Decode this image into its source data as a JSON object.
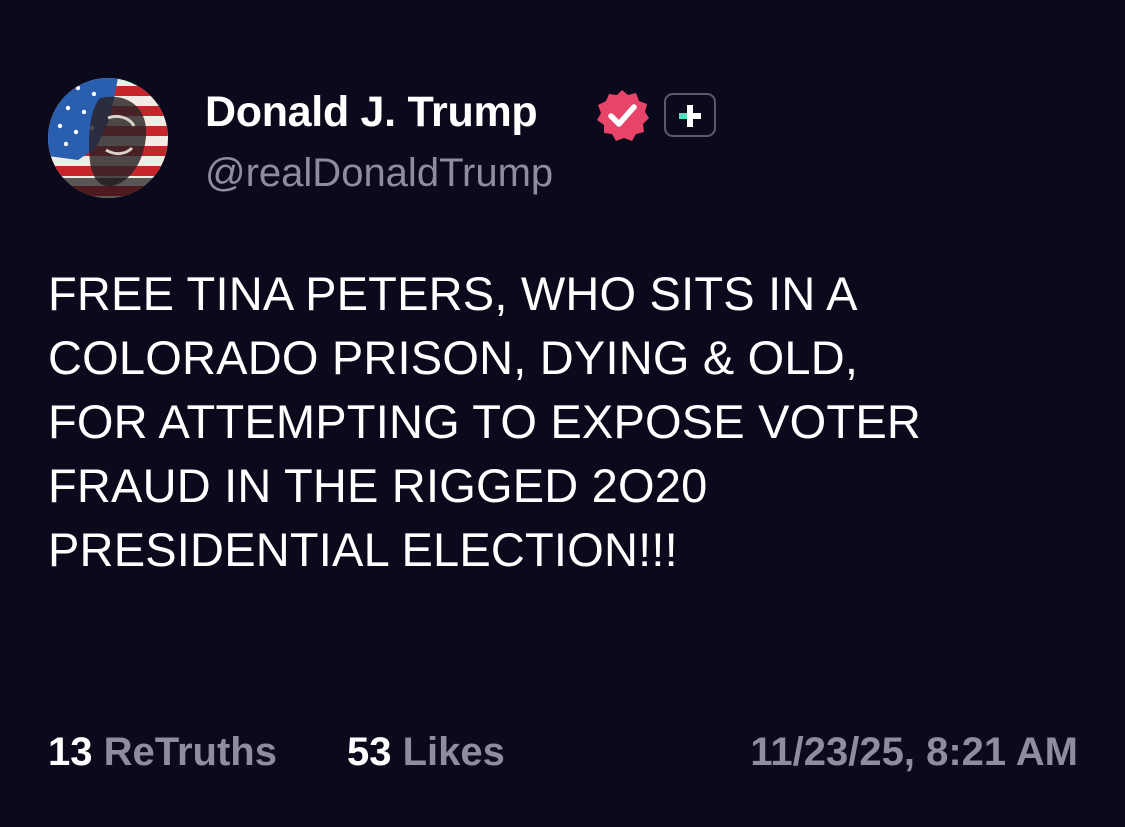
{
  "author": {
    "display_name": "Donald J. Trump",
    "handle": "@realDonaldTrump",
    "verified_icon": "verified-check-icon",
    "plus_icon": "plus-icon",
    "avatar": "avatar"
  },
  "post": {
    "text": "FREE TINA PETERS, WHO SITS IN A\nCOLORADO PRISON, DYING & OLD,\nFOR ATTEMPTING TO EXPOSE VOTER\nFRAUD IN THE RIGGED 2O20\nPRESIDENTIAL ELECTION!!!"
  },
  "stats": {
    "retruths_count": "13",
    "retruths_label": "ReTruths",
    "likes_count": "53",
    "likes_label": "Likes",
    "timestamp": "11/23/25, 8:21 AM"
  },
  "colors": {
    "background": "#0b0a1c",
    "primary_text": "#ffffff",
    "secondary_text": "#8e8ca0",
    "verified_badge": "#e8446a",
    "plus_accent": "#4fe3c1"
  }
}
